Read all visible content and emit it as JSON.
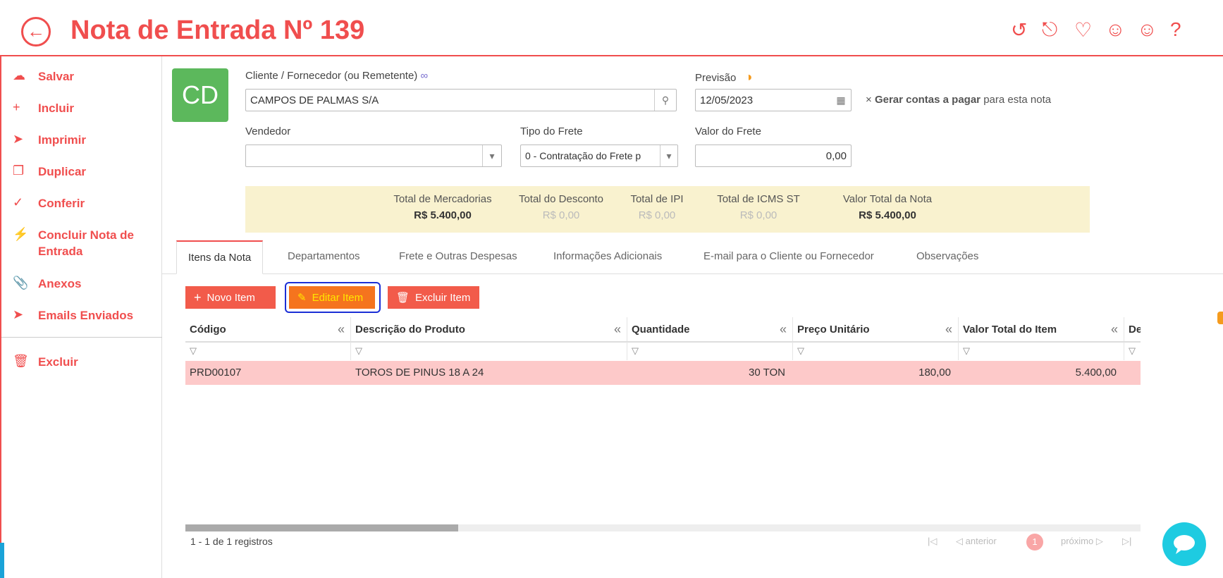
{
  "header": {
    "title": "Nota de Entrada Nº 139",
    "icons": [
      "history-icon",
      "unlock-icon",
      "heart-icon",
      "smile-icon",
      "neutral-face-icon",
      "help-icon"
    ],
    "help_label": "?"
  },
  "colors": {
    "accent": "#f04e4e",
    "avatar": "#5cb85c",
    "totals_bg": "#f9f2cf",
    "row_highlight": "#fdc9c9",
    "annotation": "#1b2fd6",
    "chat": "#1ecbe1"
  },
  "sidebar": {
    "items": [
      {
        "label": "Salvar",
        "icon": "cloud-icon"
      },
      {
        "label": "Incluir",
        "icon": "plus-icon"
      },
      {
        "label": "Imprimir",
        "icon": "send-icon"
      },
      {
        "label": "Duplicar",
        "icon": "copy-icon"
      },
      {
        "label": "Conferir",
        "icon": "check-icon"
      },
      {
        "label": "Concluir Nota de Entrada",
        "icon": "bolt-icon"
      },
      {
        "label": "Anexos",
        "icon": "paperclip-icon"
      },
      {
        "label": "Emails Enviados",
        "icon": "send-icon"
      },
      {
        "label": "Excluir",
        "icon": "trash-icon"
      }
    ]
  },
  "form": {
    "avatar_initials": "CD",
    "cliente_label": "Cliente / Fornecedor (ou Remetente)",
    "cliente_value": "CAMPOS DE PALMAS S/A",
    "previsao_label": "Previsão",
    "previsao_value": "12/05/2023",
    "gerar_prefix": "×",
    "gerar_bold": "Gerar contas a pagar",
    "gerar_suffix": "para esta nota",
    "vendedor_label": "Vendedor",
    "vendedor_value": "",
    "tipo_frete_label": "Tipo do Frete",
    "tipo_frete_value": "0 - Contratação do Frete p",
    "valor_frete_label": "Valor do Frete",
    "valor_frete_value": "0,00"
  },
  "totals": [
    {
      "label": "Total de Mercadorias",
      "value": "R$ 5.400,00"
    },
    {
      "label": "Total do Desconto",
      "value": "R$ 0,00"
    },
    {
      "label": "Total de IPI",
      "value": "R$ 0,00"
    },
    {
      "label": "Total de ICMS ST",
      "value": "R$ 0,00"
    },
    {
      "label": "Valor Total da Nota",
      "value": "R$ 5.400,00"
    }
  ],
  "tabs": [
    {
      "label": "Itens da Nota"
    },
    {
      "label": "Departamentos"
    },
    {
      "label": "Frete e Outras Despesas"
    },
    {
      "label": "Informações Adicionais"
    },
    {
      "label": "E-mail para o Cliente ou Fornecedor"
    },
    {
      "label": "Observações"
    }
  ],
  "toolbar": {
    "novo_item": "Novo Item",
    "editar_item": "Editar Item",
    "excluir_item": "Excluir Item"
  },
  "grid": {
    "columns": [
      "Código",
      "Descrição do Produto",
      "Quantidade",
      "Preço Unitário",
      "Valor Total do Item",
      "De"
    ],
    "rows": [
      {
        "codigo": "PRD00107",
        "descricao": "TOROS DE PINUS 18 A 24",
        "quantidade": "30 TON",
        "preco": "180,00",
        "valor_total": "5.400,00"
      }
    ]
  },
  "footer": {
    "records": "1 - 1 de 1 registros",
    "anterior": "anterior",
    "page": "1",
    "proximo": "próximo"
  }
}
